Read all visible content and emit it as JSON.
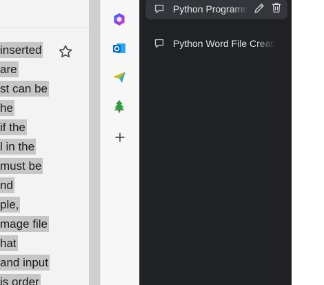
{
  "document": {
    "lines": [
      "inserted",
      "are",
      "st can be",
      "he",
      "if the",
      "l in the",
      "must be",
      "nd",
      "ple,",
      "mage file",
      "hat",
      "and input",
      "is order"
    ],
    "highlight_color": "#c6c6c6"
  },
  "toolbar": {
    "icons": [
      "copilot-icon",
      "outlook-icon",
      "send-icon",
      "tree-icon",
      "plus-icon"
    ]
  },
  "sidebar": {
    "background": "#202124",
    "chats": [
      {
        "label": "Python Programming",
        "active": true
      },
      {
        "label": "Python Word File Creation",
        "active": false
      }
    ]
  }
}
